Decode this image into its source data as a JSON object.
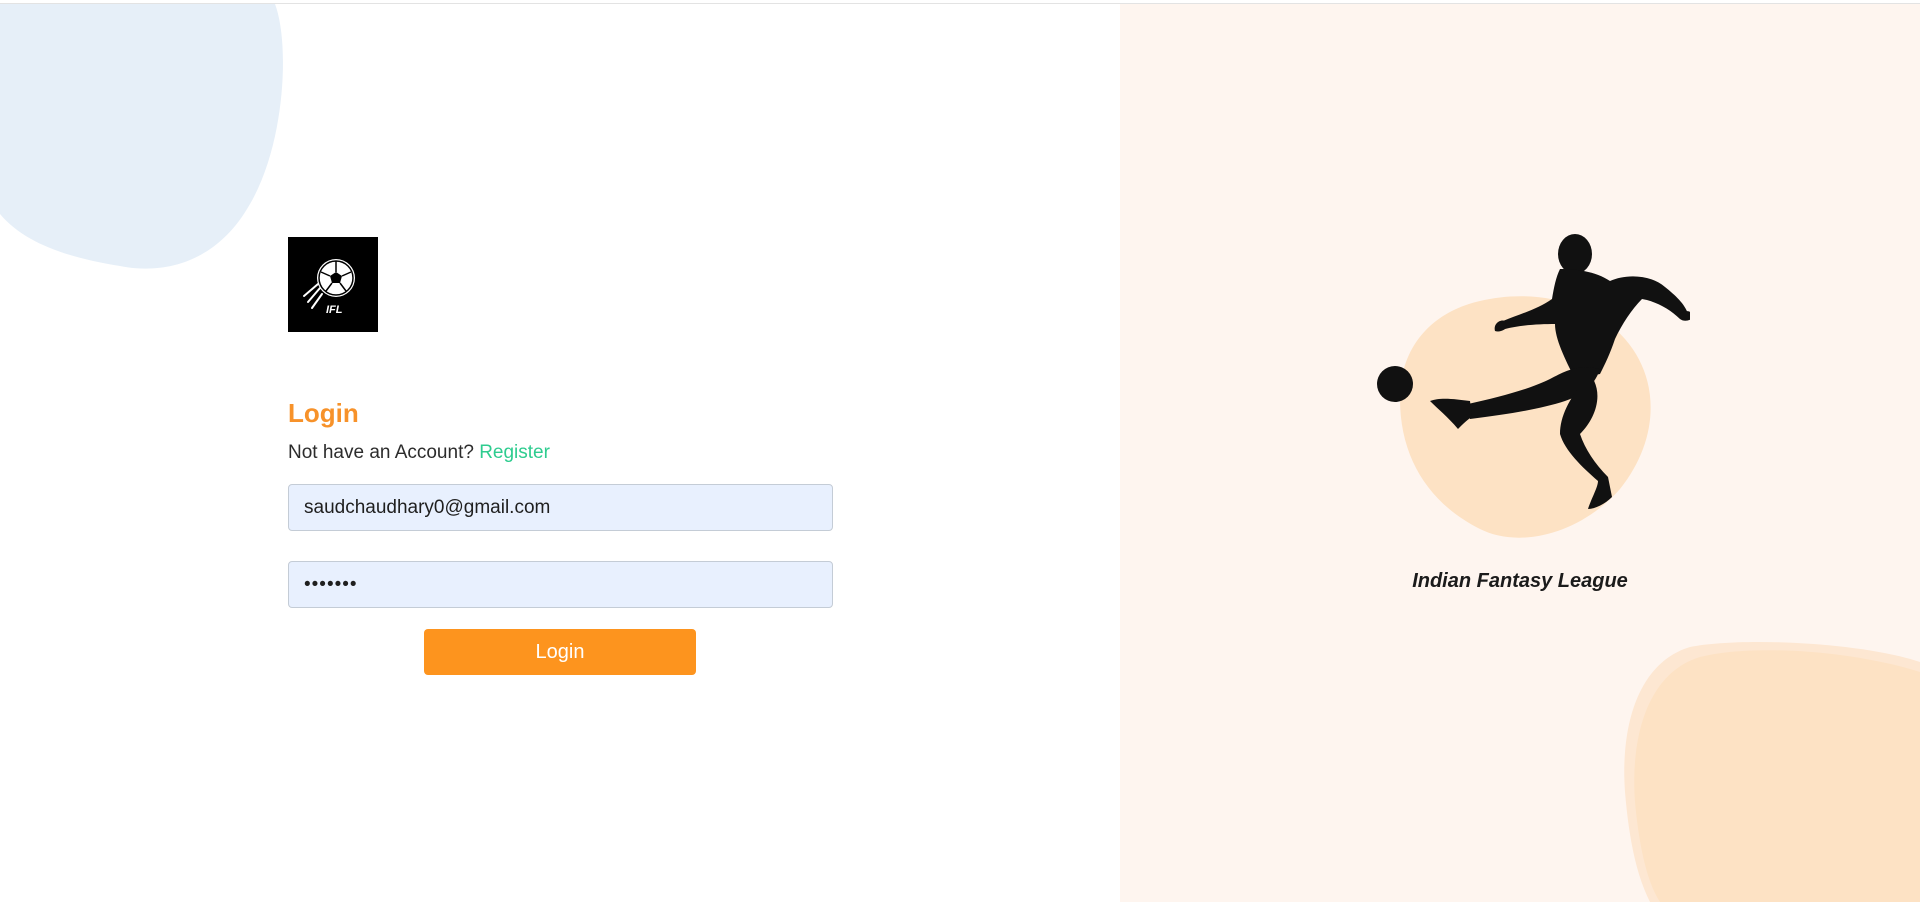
{
  "brand": {
    "logo_text": "IFL",
    "name": "Indian Fantasy League"
  },
  "login": {
    "title": "Login",
    "account_prompt": "Not have an Account?",
    "register_label": "Register",
    "email_value": "saudchaudhary0@gmail.com",
    "password_value": "•••••••",
    "submit_label": "Login"
  },
  "icons": {
    "logo": "soccer-ball-icon",
    "hero": "footballer-kicking-illustration"
  },
  "colors": {
    "accent": "#fd941e",
    "title": "#f7922a",
    "link": "#2ecc8f",
    "input_bg": "#e8f0fe",
    "right_bg": "#fef5ef",
    "blob_peach": "#fde2c4",
    "blob_blue": "#e6eff8"
  }
}
